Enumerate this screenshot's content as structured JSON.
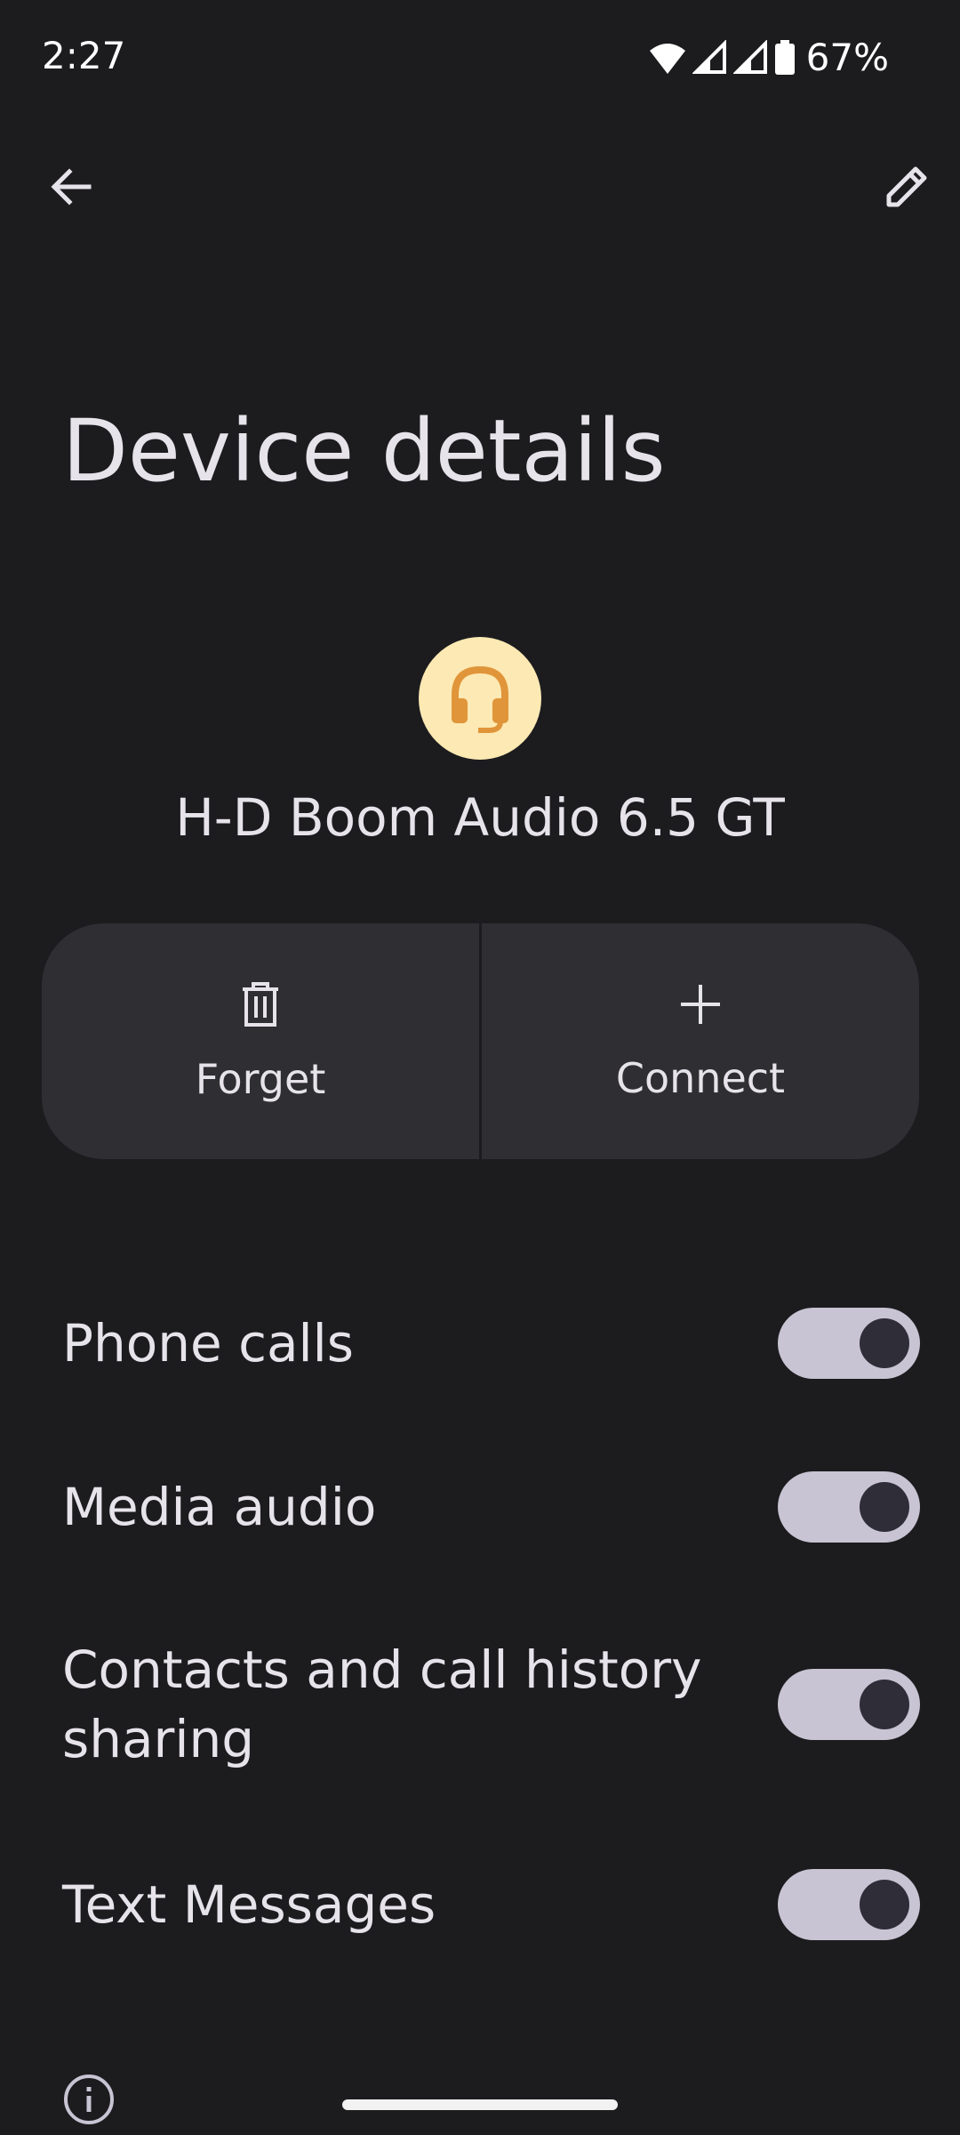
{
  "status_bar": {
    "time": "2:27",
    "battery": "67%",
    "icons": [
      "wifi-icon",
      "signal-icon",
      "signal-icon",
      "battery-icon"
    ]
  },
  "toolbar": {
    "back_icon": "arrow-back-icon",
    "edit_icon": "pencil-icon"
  },
  "page": {
    "title": "Device details"
  },
  "device": {
    "name": "H-D Boom Audio 6.5 GT",
    "icon": "headset-icon",
    "icon_bg": "#fde9b3",
    "icon_color": "#e0953a"
  },
  "actions": {
    "forget_label": "Forget",
    "connect_label": "Connect"
  },
  "settings": [
    {
      "label": "Phone calls",
      "enabled": true
    },
    {
      "label": "Media audio",
      "enabled": true
    },
    {
      "label": "Contacts and call history sharing",
      "enabled": true
    },
    {
      "label": "Text Messages",
      "enabled": true
    }
  ],
  "colors": {
    "background": "#1c1c1f",
    "button_bg": "#2f2f33",
    "switch_track": "#c8c4d3",
    "switch_thumb": "#2e2d38"
  }
}
